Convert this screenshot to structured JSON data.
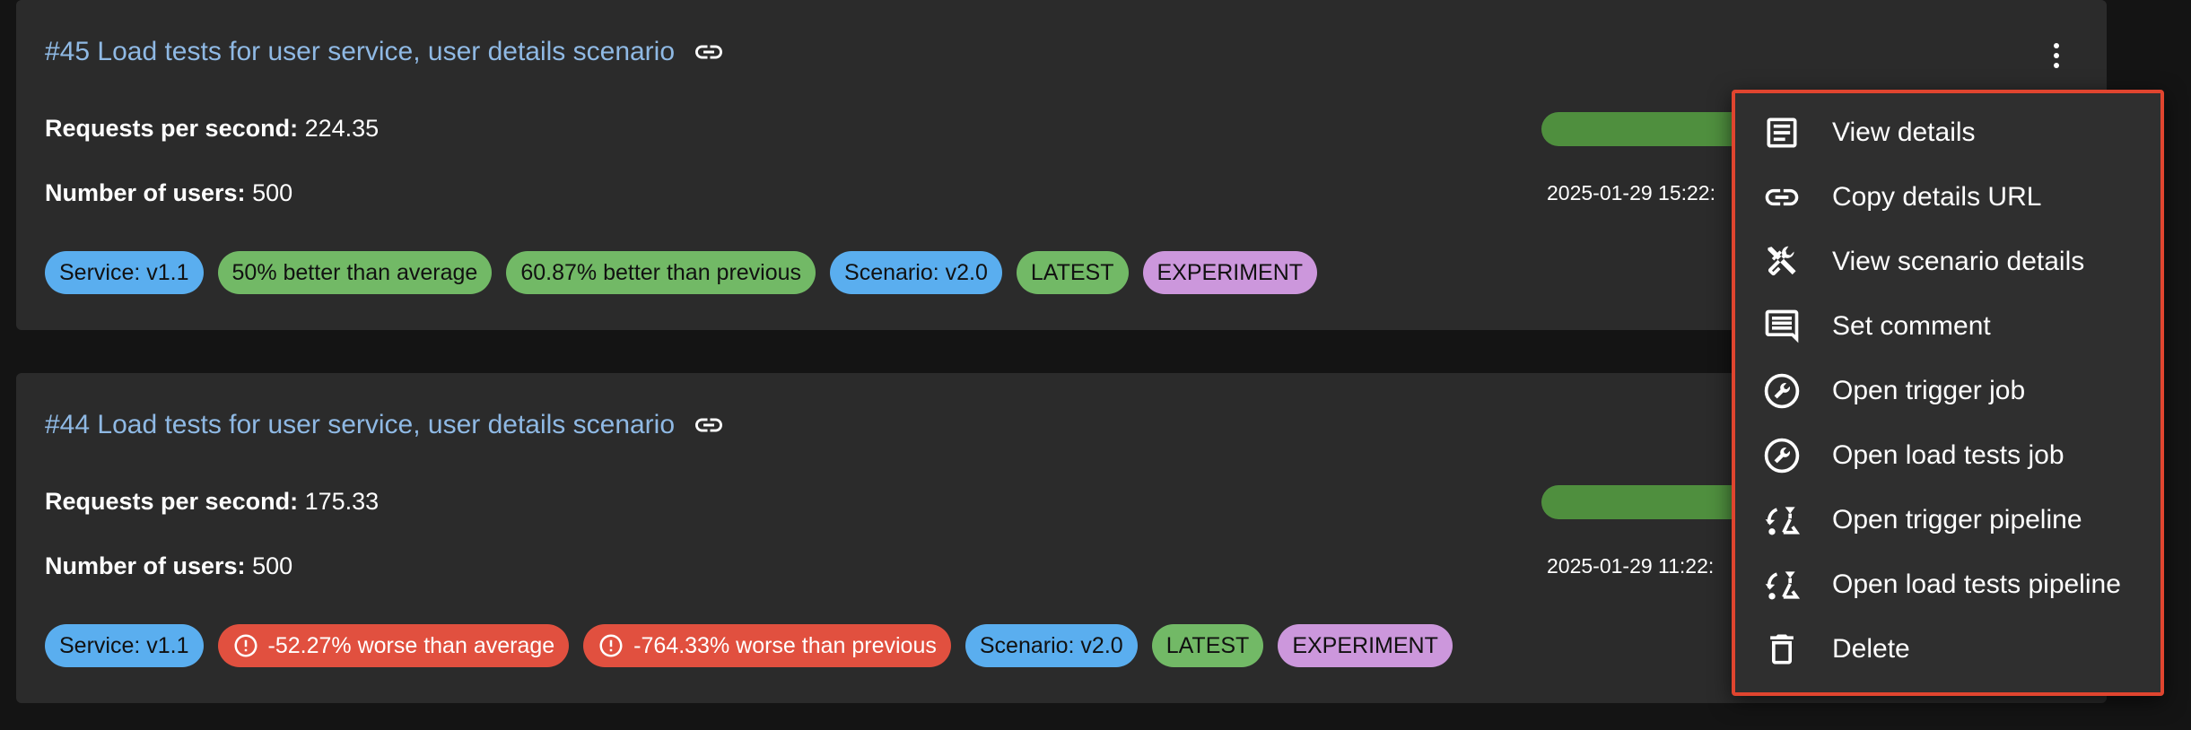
{
  "cards": [
    {
      "title": "#45 Load tests for user service, user details scenario",
      "rps_label": "Requests per second:",
      "rps_value": "224.35",
      "users_label": "Number of users:",
      "users_value": "500",
      "datetime": "2025-01-29 15:22:",
      "chips": [
        {
          "text": "Service: v1.1",
          "color": "#5aaeef"
        },
        {
          "text": "50% better than average",
          "color": "#72b966"
        },
        {
          "text": "60.87% better than previous",
          "color": "#72b966"
        },
        {
          "text": "Scenario: v2.0",
          "color": "#5aaeef"
        },
        {
          "text": "LATEST",
          "color": "#72b966"
        },
        {
          "text": "EXPERIMENT",
          "color": "#cc97dc"
        }
      ]
    },
    {
      "title": "#44 Load tests for user service, user details scenario",
      "rps_label": "Requests per second:",
      "rps_value": "175.33",
      "users_label": "Number of users:",
      "users_value": "500",
      "datetime": "2025-01-29 11:22:",
      "chips": [
        {
          "text": "Service: v1.1",
          "color": "#5aaeef"
        },
        {
          "text": "-52.27% worse than average",
          "color": "#e1503f",
          "icon": "warning-icon"
        },
        {
          "text": "-764.33% worse than previous",
          "color": "#e1503f",
          "icon": "warning-icon"
        },
        {
          "text": "Scenario: v2.0",
          "color": "#5aaeef"
        },
        {
          "text": "LATEST",
          "color": "#72b966"
        },
        {
          "text": "EXPERIMENT",
          "color": "#cc97dc"
        }
      ]
    }
  ],
  "menu": {
    "highlight_color": "#e0452f",
    "items": [
      {
        "label": "View details",
        "icon": "article-icon"
      },
      {
        "label": "Copy details URL",
        "icon": "link-icon"
      },
      {
        "label": "View scenario details",
        "icon": "tools-icon"
      },
      {
        "label": "Set comment",
        "icon": "comment-icon"
      },
      {
        "label": "Open trigger job",
        "icon": "wrench-circle-icon"
      },
      {
        "label": "Open load tests job",
        "icon": "wrench-circle-icon"
      },
      {
        "label": "Open trigger pipeline",
        "icon": "pipeline-icon"
      },
      {
        "label": "Open load tests pipeline",
        "icon": "pipeline-icon"
      },
      {
        "label": "Delete",
        "icon": "trash-icon"
      }
    ]
  }
}
